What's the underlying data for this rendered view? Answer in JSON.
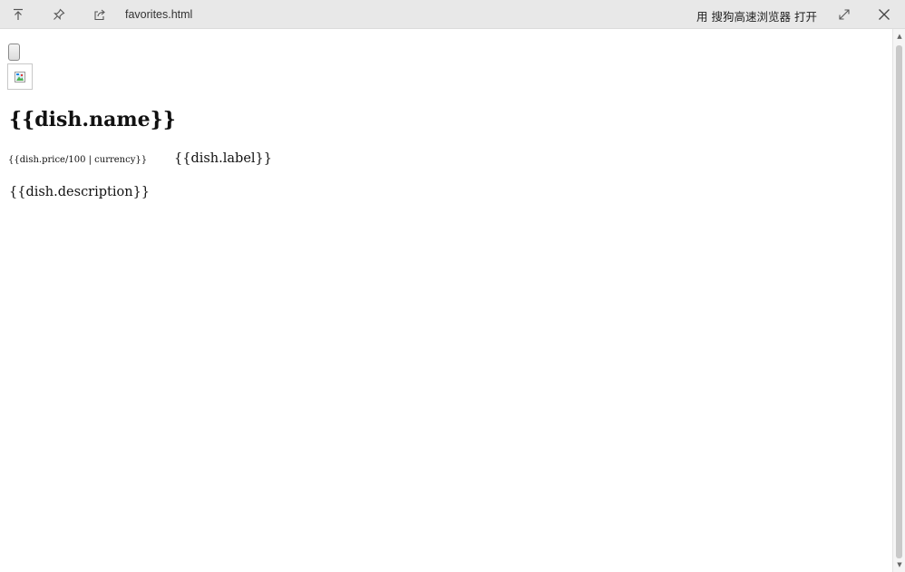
{
  "toolbar": {
    "filename": "favorites.html",
    "open_with_label": "用 搜狗高速浏览器 打开",
    "icons": [
      "scroll-top-icon",
      "pin-icon",
      "share-icon",
      "expand-icon",
      "close-icon"
    ]
  },
  "content": {
    "dish_name": "{{dish.name}}",
    "dish_price": "{{dish.price/100 | currency}}",
    "dish_label": "{{dish.label}}",
    "dish_description": "{{dish.description}}"
  },
  "scrollbar": {
    "up_glyph": "▲",
    "down_glyph": "▼"
  }
}
